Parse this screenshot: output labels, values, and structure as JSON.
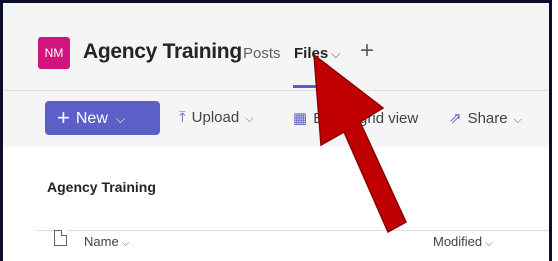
{
  "header": {
    "avatar_initials": "NM",
    "team_name": "Agency Training",
    "tabs": [
      {
        "label": "Posts",
        "active": false
      },
      {
        "label": "Files",
        "active": true
      }
    ],
    "add_tab_icon": "plus-icon"
  },
  "toolbar": {
    "new_label": "New",
    "upload_label": "Upload",
    "grid_label": "Edit in grid view",
    "share_label": "Share"
  },
  "library": {
    "title": "Agency Training",
    "columns": [
      {
        "label": "Name"
      },
      {
        "label": "Modified"
      }
    ]
  },
  "overlay": {
    "arrow_color": "#c00000",
    "icon": "annotation-arrow-icon"
  },
  "colors": {
    "accent": "#5b5fc7",
    "avatar_bg": "#d0167e",
    "frame_border": "#0b0d2e"
  }
}
